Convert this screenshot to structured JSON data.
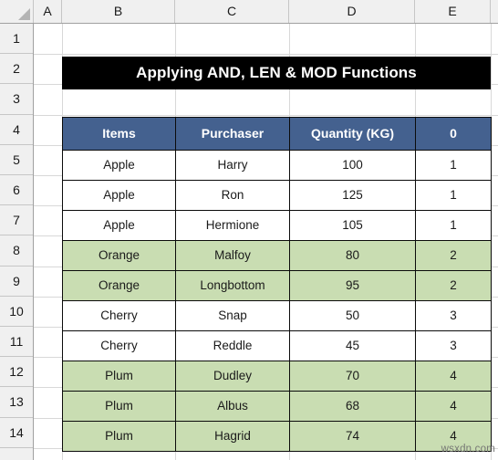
{
  "spreadsheet": {
    "column_headers": [
      "A",
      "B",
      "C",
      "D",
      "E"
    ],
    "row_headers": [
      "1",
      "2",
      "3",
      "4",
      "5",
      "6",
      "7",
      "8",
      "9",
      "10",
      "11",
      "12",
      "13",
      "14"
    ],
    "select_all_icon": "select-all-triangle-icon"
  },
  "title": {
    "text": "Applying AND, LEN & MOD Functions",
    "background": "#000000",
    "color": "#ffffff"
  },
  "table": {
    "header_background": "#44618f",
    "header_color": "#ffffff",
    "highlight_background": "#c9ddb2",
    "border_color": "#0b0b0b",
    "columns": [
      "Items",
      "Purchaser",
      "Quantity (KG)",
      "0"
    ],
    "rows": [
      {
        "items": "Apple",
        "purchaser": "Harry",
        "quantity": "100",
        "group": "1",
        "highlighted": false
      },
      {
        "items": "Apple",
        "purchaser": "Ron",
        "quantity": "125",
        "group": "1",
        "highlighted": false
      },
      {
        "items": "Apple",
        "purchaser": "Hermione",
        "quantity": "105",
        "group": "1",
        "highlighted": false
      },
      {
        "items": "Orange",
        "purchaser": "Malfoy",
        "quantity": "80",
        "group": "2",
        "highlighted": true
      },
      {
        "items": "Orange",
        "purchaser": "Longbottom",
        "quantity": "95",
        "group": "2",
        "highlighted": true
      },
      {
        "items": "Cherry",
        "purchaser": "Snap",
        "quantity": "50",
        "group": "3",
        "highlighted": false
      },
      {
        "items": "Cherry",
        "purchaser": "Reddle",
        "quantity": "45",
        "group": "3",
        "highlighted": false
      },
      {
        "items": "Plum",
        "purchaser": "Dudley",
        "quantity": "70",
        "group": "4",
        "highlighted": true
      },
      {
        "items": "Plum",
        "purchaser": "Albus",
        "quantity": "68",
        "group": "4",
        "highlighted": true
      },
      {
        "items": "Plum",
        "purchaser": "Hagrid",
        "quantity": "74",
        "group": "4",
        "highlighted": true
      }
    ]
  },
  "watermark": {
    "text": "wsxdn.com"
  }
}
